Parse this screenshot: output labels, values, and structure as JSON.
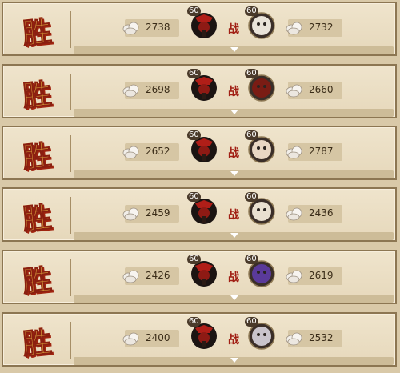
{
  "battles": [
    {
      "result": "胜",
      "player_level": "60",
      "player_score": "2738",
      "vs": "战",
      "enemy_level": "60",
      "enemy_score": "2732",
      "enemy_color": "#e9e3d9"
    },
    {
      "result": "胜",
      "player_level": "60",
      "player_score": "2698",
      "vs": "战",
      "enemy_level": "60",
      "enemy_score": "2660",
      "enemy_color": "#7a1c14"
    },
    {
      "result": "胜",
      "player_level": "60",
      "player_score": "2652",
      "vs": "战",
      "enemy_level": "60",
      "enemy_score": "2787",
      "enemy_color": "#e8d7c4"
    },
    {
      "result": "胜",
      "player_level": "60",
      "player_score": "2459",
      "vs": "战",
      "enemy_level": "60",
      "enemy_score": "2436",
      "enemy_color": "#e9e0d0"
    },
    {
      "result": "胜",
      "player_level": "60",
      "player_score": "2426",
      "vs": "战",
      "enemy_level": "60",
      "enemy_score": "2619",
      "enemy_color": "#5a3a9a"
    },
    {
      "result": "胜",
      "player_level": "60",
      "player_score": "2400",
      "vs": "战",
      "enemy_level": "60",
      "enemy_score": "2532",
      "enemy_color": "#c9c4cc"
    }
  ],
  "icons": {
    "score": "silver-cloud-icon",
    "expand": "expand-arrow-icon"
  }
}
